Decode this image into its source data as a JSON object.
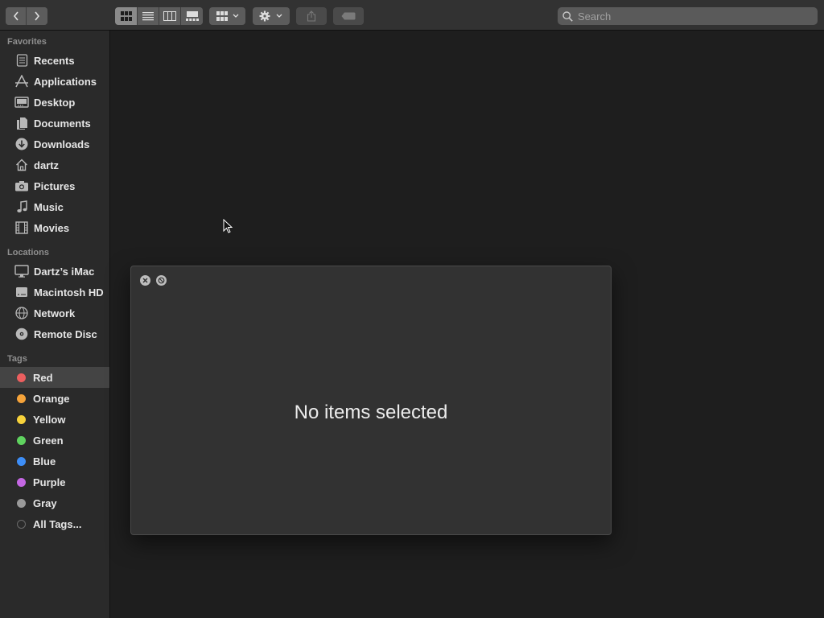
{
  "toolbar": {
    "back_icon": "chevron-left-icon",
    "forward_icon": "chevron-right-icon",
    "view_modes": [
      "icon-view-icon",
      "list-view-icon",
      "column-view-icon",
      "gallery-view-icon"
    ],
    "active_view": "icon-view-icon",
    "group_icon": "grid-dropdown-icon",
    "action_icon": "gear-dropdown-icon",
    "share_icon": "share-icon",
    "tag_icon": "tag-icon",
    "search_placeholder": "Search",
    "search_value": ""
  },
  "sidebar": {
    "favorites_header": "Favorites",
    "favorites": [
      {
        "label": "Recents",
        "icon": "recents-icon"
      },
      {
        "label": "Applications",
        "icon": "applications-icon"
      },
      {
        "label": "Desktop",
        "icon": "desktop-icon"
      },
      {
        "label": "Documents",
        "icon": "documents-icon"
      },
      {
        "label": "Downloads",
        "icon": "downloads-icon"
      },
      {
        "label": "dartz",
        "icon": "home-icon"
      },
      {
        "label": "Pictures",
        "icon": "camera-icon"
      },
      {
        "label": "Music",
        "icon": "music-note-icon"
      },
      {
        "label": "Movies",
        "icon": "film-icon"
      }
    ],
    "locations_header": "Locations",
    "locations": [
      {
        "label": "Dartz’s iMac",
        "icon": "imac-icon"
      },
      {
        "label": "Macintosh HD",
        "icon": "hard-drive-icon"
      },
      {
        "label": "Network",
        "icon": "globe-icon"
      },
      {
        "label": "Remote Disc",
        "icon": "disc-icon"
      }
    ],
    "tags_header": "Tags",
    "tags": [
      {
        "label": "Red",
        "color": "#ec5f5f",
        "selected": true
      },
      {
        "label": "Orange",
        "color": "#f5a33a"
      },
      {
        "label": "Yellow",
        "color": "#f7d23b"
      },
      {
        "label": "Green",
        "color": "#5fd35f"
      },
      {
        "label": "Blue",
        "color": "#3d8ef7"
      },
      {
        "label": "Purple",
        "color": "#c467e3"
      },
      {
        "label": "Gray",
        "color": "#9a9a9a"
      },
      {
        "label": "All Tags...",
        "color": "#5a5a5a"
      }
    ]
  },
  "info_panel": {
    "close_icon": "close-icon",
    "minimize_icon": "minimize-icon",
    "message": "No items selected"
  },
  "colors": {
    "window_bg": "#1e1e1e",
    "sidebar_bg": "#2a2a2a",
    "toolbar_bg": "#323232",
    "panel_bg": "#323232",
    "selected_row": "#444444"
  }
}
